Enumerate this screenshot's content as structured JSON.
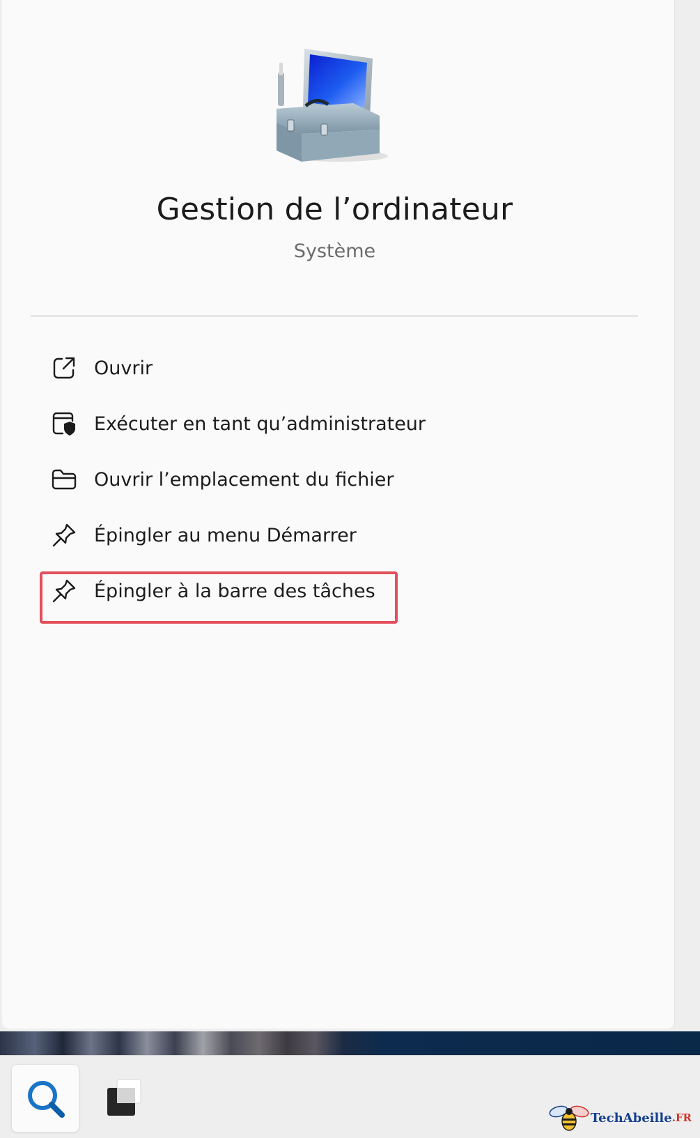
{
  "app": {
    "title": "Gestion de l’ordinateur",
    "category": "Système",
    "icon": "computer-management-toolbox-icon"
  },
  "menu": {
    "items": [
      {
        "label": "Ouvrir",
        "icon": "open-external-icon"
      },
      {
        "label": "Exécuter en tant qu’administrateur",
        "icon": "run-as-admin-shield-icon"
      },
      {
        "label": "Ouvrir l’emplacement du fichier",
        "icon": "folder-icon"
      },
      {
        "label": "Épingler au menu Démarrer",
        "icon": "pin-icon"
      },
      {
        "label": "Épingler à la barre des tâches",
        "icon": "pin-icon",
        "highlighted": true
      }
    ],
    "highlight_color": "#e3505c"
  },
  "taskbar": {
    "buttons": [
      {
        "name": "search",
        "icon": "search-icon"
      },
      {
        "name": "task-view",
        "icon": "task-view-icon"
      }
    ]
  },
  "watermark": {
    "brand": "TechAbeille",
    "tld": ".FR",
    "icon": "bee-icon"
  },
  "colors": {
    "panel_background": "#fafafa",
    "taskbar_background": "#eeeeee",
    "search_icon_color": "#1a74c8",
    "watermark_blue": "#16408f",
    "watermark_red": "#d0322b"
  }
}
